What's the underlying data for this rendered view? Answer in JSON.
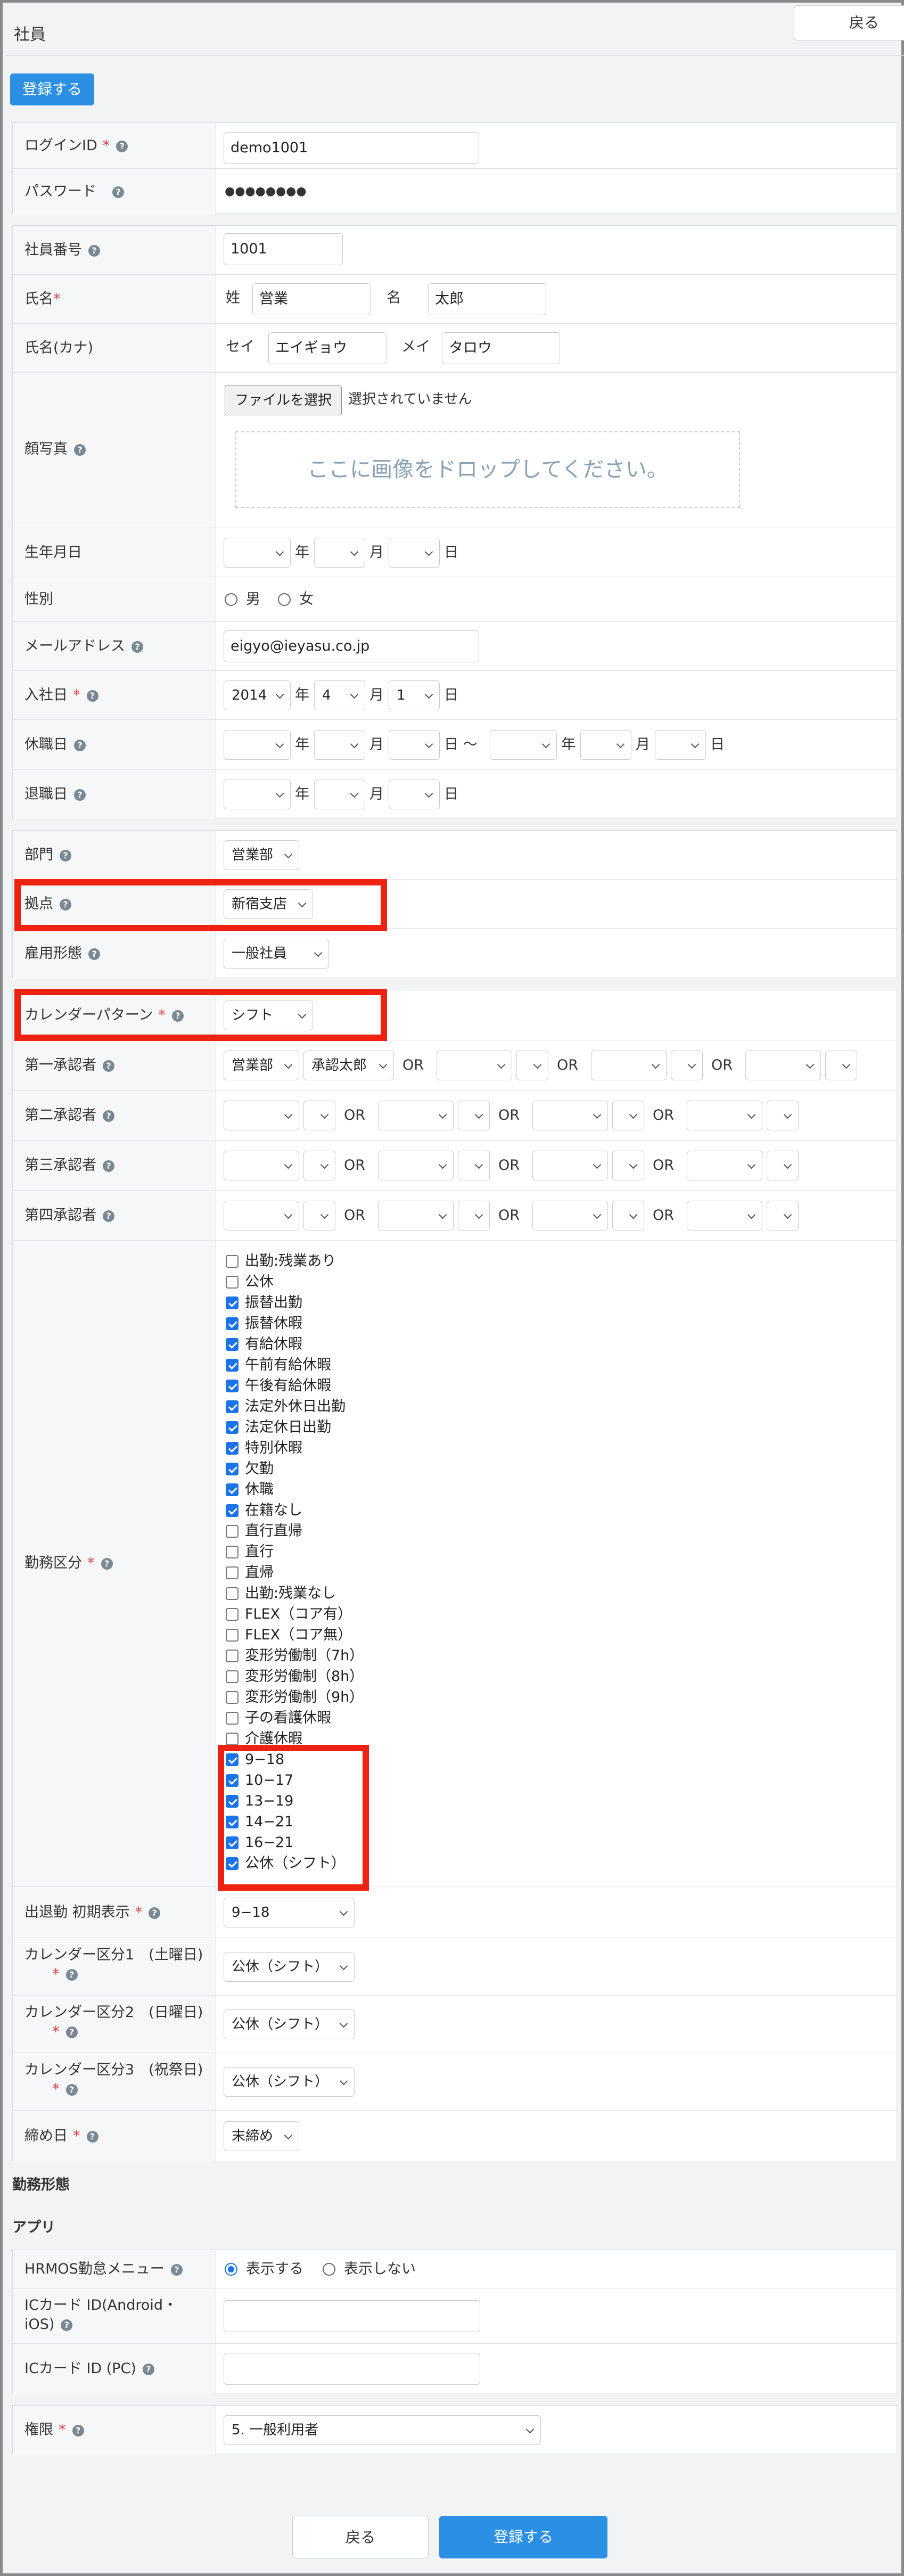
{
  "header": {
    "title": "社員",
    "back": "戻る",
    "register": "登録する"
  },
  "account": {
    "login_label": "ログインID",
    "login_value": "demo1001",
    "password_label": "パスワード",
    "password_value": "●●●●●●●●"
  },
  "basic": {
    "emp_no_label": "社員番号",
    "emp_no_value": "1001",
    "name_label": "氏名",
    "sei": "姓",
    "mei": "名",
    "last": "営業",
    "first": "太郎",
    "kana_label": "氏名(カナ)",
    "kana_sei": "セイ",
    "kana_mei": "メイ",
    "kana_last": "エイギョウ",
    "kana_first": "タロウ",
    "photo_label": "顔写真",
    "file_button": "ファイルを選択",
    "file_status": "選択されていません",
    "dropzone": "ここに画像をドロップしてください。",
    "birth_label": "生年月日",
    "gender_label": "性別",
    "male": "男",
    "female": "女",
    "email_label": "メールアドレス",
    "email_value": "eigyo@ieyasu.co.jp",
    "join_label": "入社日",
    "join_year": "2014",
    "join_month": "4",
    "join_day": "1",
    "leave_label": "休職日",
    "retire_label": "退職日",
    "year": "年",
    "month": "月",
    "day": "日",
    "tilde": "日 〜"
  },
  "org": {
    "dept_label": "部門",
    "dept_value": "営業部",
    "base_label": "拠点",
    "base_value": "新宿支店",
    "emp_type_label": "雇用形態",
    "emp_type_value": "一般社員"
  },
  "calendar": {
    "pattern_label": "カレンダーパターン",
    "pattern_value": "シフト"
  },
  "approvers": {
    "first": "第一承認者",
    "second": "第二承認者",
    "third": "第三承認者",
    "fourth": "第四承認者",
    "or": "OR",
    "first_dept": "営業部",
    "first_person": "承認太郎"
  },
  "work": {
    "label": "勤務区分",
    "items": [
      {
        "label": "出勤:残業あり",
        "checked": false
      },
      {
        "label": "公休",
        "checked": false
      },
      {
        "label": "振替出勤",
        "checked": true
      },
      {
        "label": "振替休暇",
        "checked": true
      },
      {
        "label": "有給休暇",
        "checked": true
      },
      {
        "label": "午前有給休暇",
        "checked": true
      },
      {
        "label": "午後有給休暇",
        "checked": true
      },
      {
        "label": "法定外休日出勤",
        "checked": true
      },
      {
        "label": "法定休日出勤",
        "checked": true
      },
      {
        "label": "特別休暇",
        "checked": true
      },
      {
        "label": "欠勤",
        "checked": true
      },
      {
        "label": "休職",
        "checked": true
      },
      {
        "label": "在籍なし",
        "checked": true
      },
      {
        "label": "直行直帰",
        "checked": false
      },
      {
        "label": "直行",
        "checked": false
      },
      {
        "label": "直帰",
        "checked": false
      },
      {
        "label": "出勤:残業なし",
        "checked": false
      },
      {
        "label": "FLEX（コア有）",
        "checked": false
      },
      {
        "label": "FLEX（コア無）",
        "checked": false
      },
      {
        "label": "変形労働制（7h）",
        "checked": false
      },
      {
        "label": "変形労働制（8h）",
        "checked": false
      },
      {
        "label": "変形労働制（9h）",
        "checked": false
      },
      {
        "label": "子の看護休暇",
        "checked": false
      },
      {
        "label": "介護休暇",
        "checked": false
      },
      {
        "label": "9−18",
        "checked": true
      },
      {
        "label": "10−17",
        "checked": true
      },
      {
        "label": "13−19",
        "checked": true
      },
      {
        "label": "14−21",
        "checked": true
      },
      {
        "label": "16−21",
        "checked": true
      },
      {
        "label": "公休（シフト）",
        "checked": true
      }
    ],
    "initial_label": "出退勤 初期表示",
    "initial_value": "9−18",
    "cal1_label": "カレンダー区分1　(土曜日)",
    "cal1_value": "公休（シフト）",
    "cal2_label": "カレンダー区分2　(日曜日)",
    "cal2_value": "公休（シフト）",
    "cal3_label": "カレンダー区分3　(祝祭日)",
    "cal3_value": "公休（シフト）",
    "close_label": "締め日",
    "close_value": "末締め"
  },
  "sections": {
    "work_form": "勤務形態",
    "app": "アプリ"
  },
  "app": {
    "menu_label": "HRMOS勤怠メニュー",
    "show": "表示する",
    "hide": "表示しない",
    "ic_android_label": "ICカード ID(Android・iOS)",
    "ic_pc_label": "ICカード ID (PC)"
  },
  "perm": {
    "label": "権限",
    "value": "5. 一般利用者"
  },
  "footer": {
    "back": "戻る",
    "register": "登録する"
  }
}
